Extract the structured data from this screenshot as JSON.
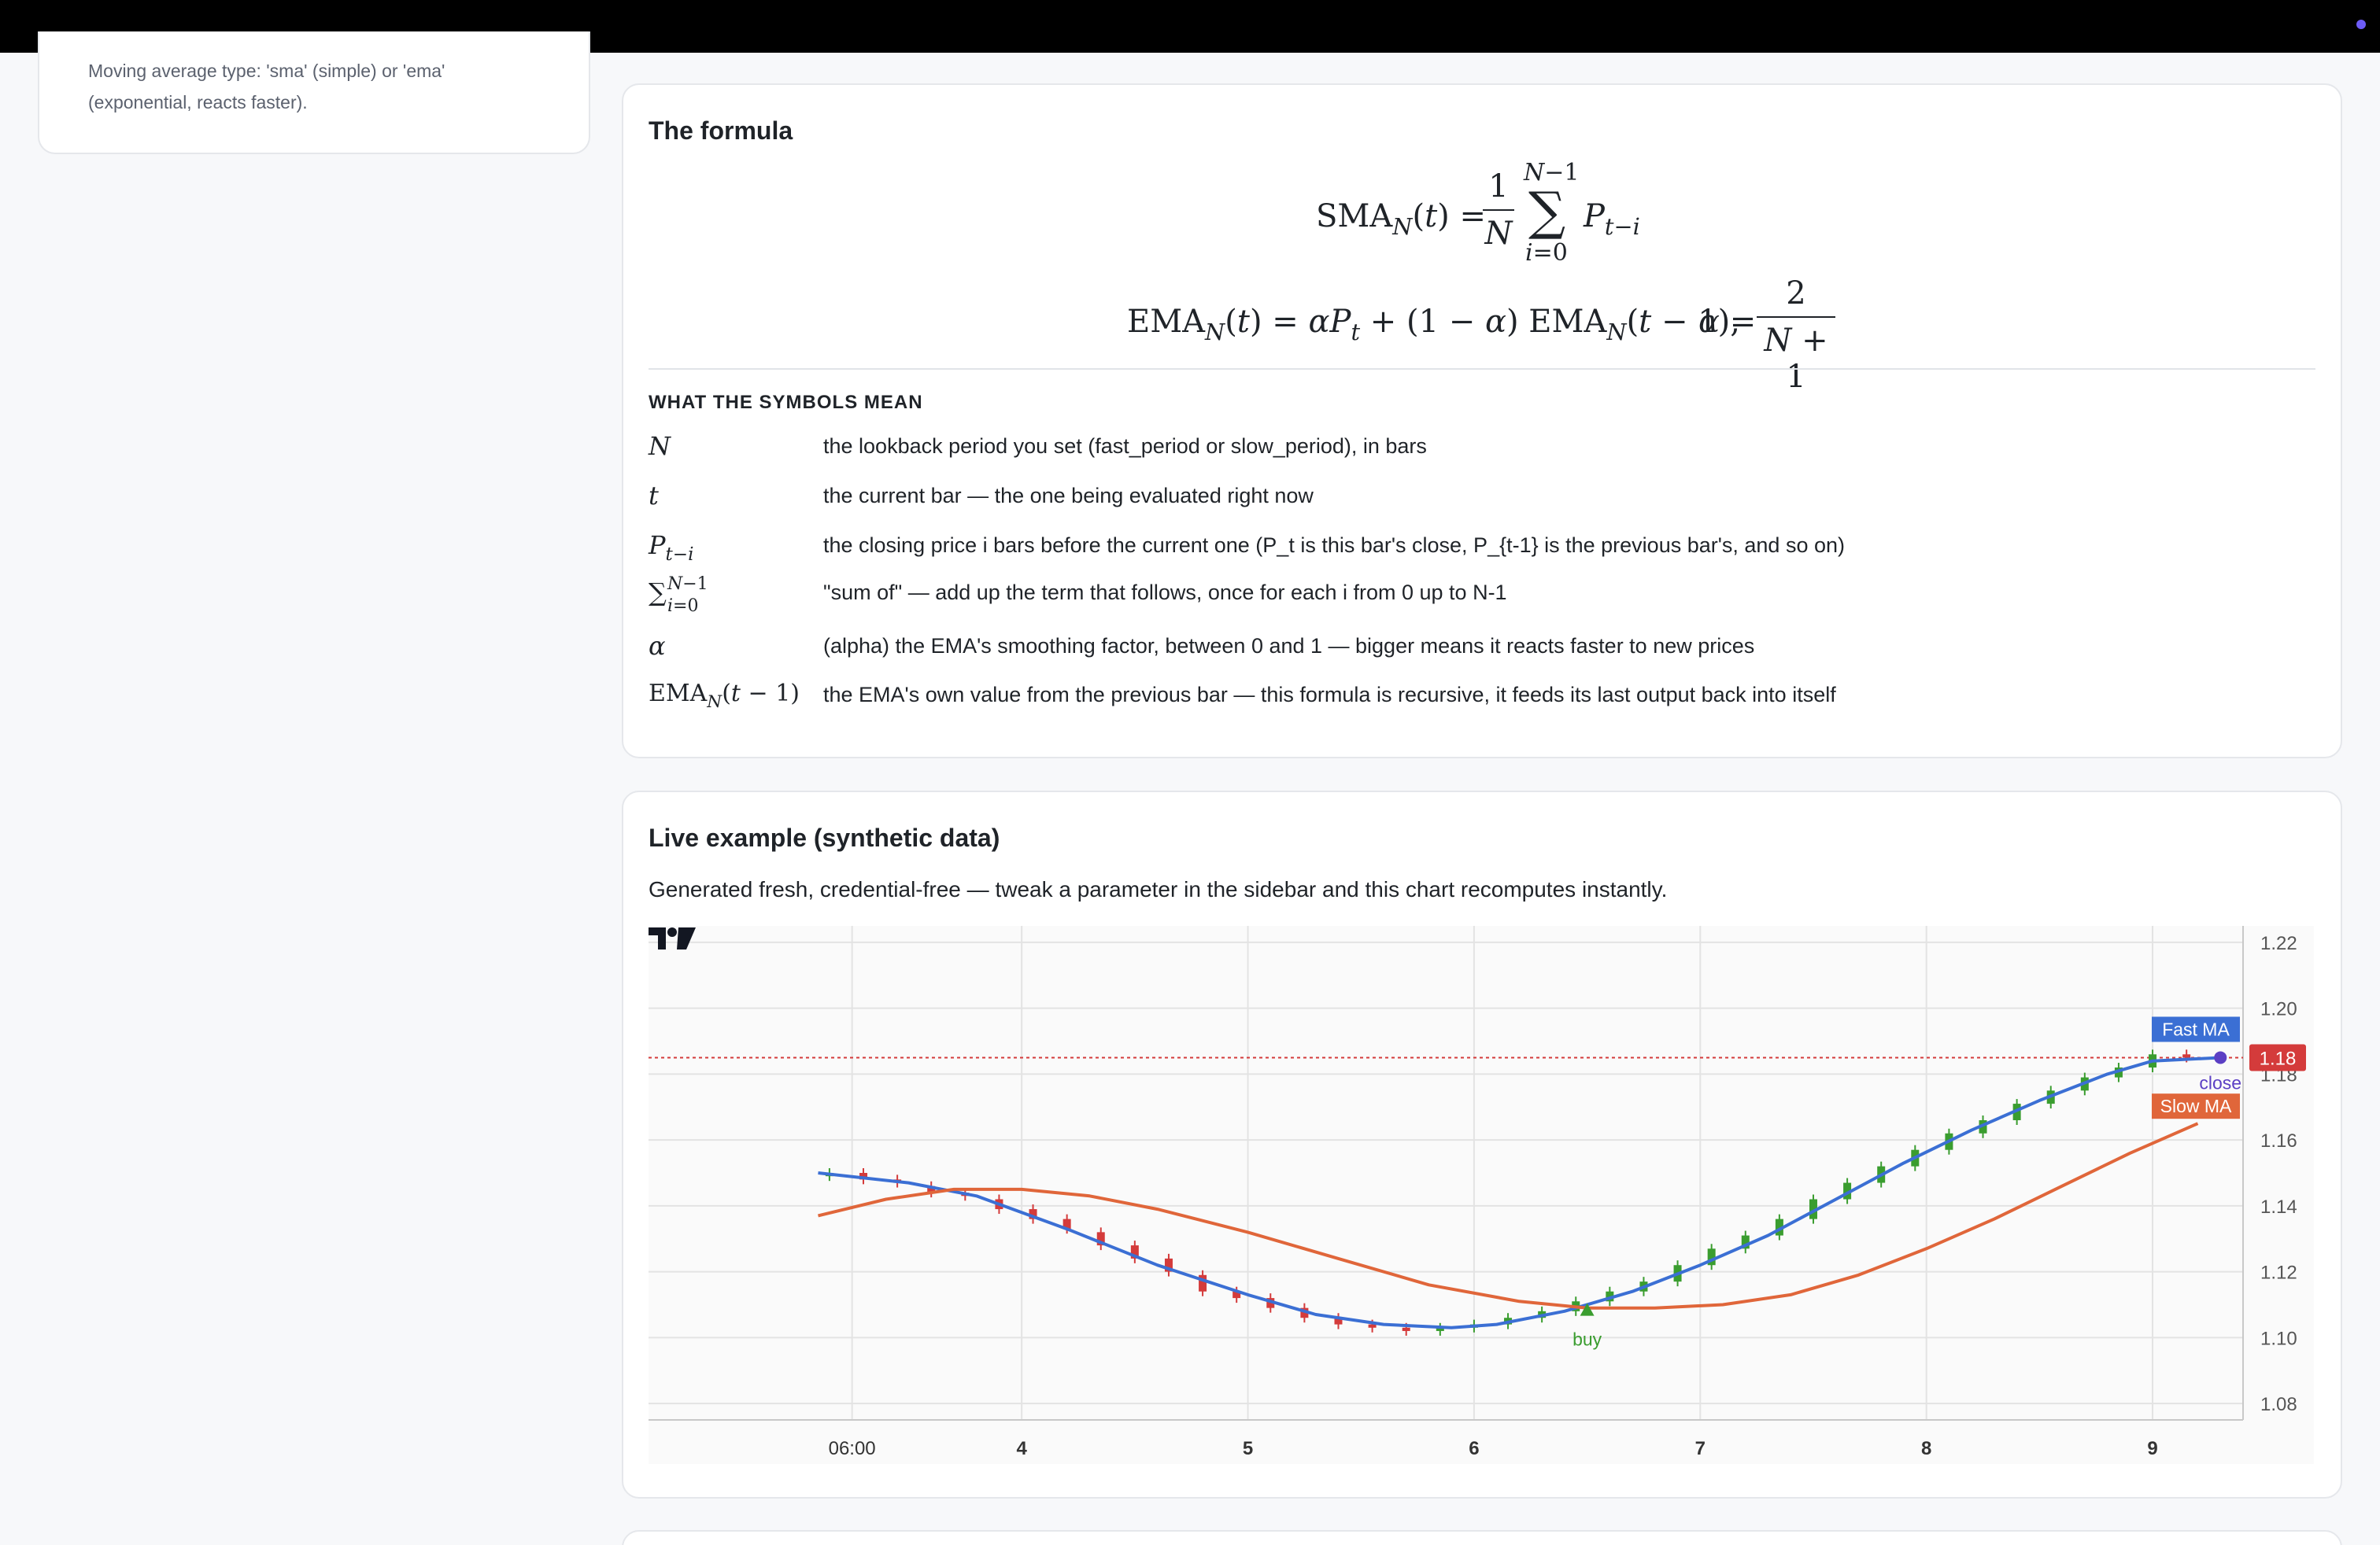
{
  "sidebar": {
    "ma_type_help": "Moving average type: 'sma' (simple) or 'ema' (exponential, reacts faster)."
  },
  "formula": {
    "title": "The formula",
    "symbols_title": "WHAT THE SYMBOLS MEAN",
    "symbols": [
      {
        "symbol": "N",
        "meaning": "the lookback period you set (fast_period or slow_period), in bars"
      },
      {
        "symbol": "t",
        "meaning": "the current bar — the one being evaluated right now"
      },
      {
        "symbol": "P_{t-i}",
        "meaning": "the closing price i bars before the current one (P_t is this bar's close, P_{t-1} is the previous bar's, and so on)"
      },
      {
        "symbol": "sum_{i=0}^{N-1}",
        "meaning": "\"sum of\" — add up the term that follows, once for each i from 0 up to N-1"
      },
      {
        "symbol": "alpha",
        "meaning": "(alpha) the EMA's smoothing factor, between 0 and 1 — bigger means it reacts faster to new prices"
      },
      {
        "symbol": "EMA_N(t-1)",
        "meaning": "the EMA's own value from the previous bar — this formula is recursive, it feeds its last output back into itself"
      }
    ]
  },
  "example": {
    "title": "Live example (synthetic data)",
    "subtitle": "Generated fresh, credential-free — tweak a parameter in the sidebar and this chart recomputes instantly."
  },
  "chart_data": {
    "type": "line",
    "y_ticks": [
      "1.22",
      "1.20",
      "1.18",
      "1.16",
      "1.14",
      "1.12",
      "1.10",
      "1.08"
    ],
    "ylim": [
      1.075,
      1.225
    ],
    "x_ticks": [
      {
        "label": "06:00",
        "x": 3.25
      },
      {
        "label": "4",
        "x": 4
      },
      {
        "label": "5",
        "x": 5
      },
      {
        "label": "6",
        "x": 6
      },
      {
        "label": "7",
        "x": 7
      },
      {
        "label": "8",
        "x": 8
      },
      {
        "label": "9",
        "x": 9
      }
    ],
    "xlim": [
      2.35,
      9.4
    ],
    "close_price": 1.185,
    "close_price_label": "1.18",
    "series": [
      {
        "name": "Fast MA",
        "color": "#3b6fd4",
        "x": [
          3.1,
          3.5,
          3.8,
          4.2,
          4.6,
          5.0,
          5.3,
          5.6,
          5.9,
          6.1,
          6.4,
          6.7,
          7.0,
          7.3,
          7.6,
          7.9,
          8.2,
          8.5,
          8.8,
          9.0,
          9.3
        ],
        "y": [
          1.15,
          1.147,
          1.143,
          1.133,
          1.122,
          1.113,
          1.107,
          1.104,
          1.103,
          1.104,
          1.108,
          1.114,
          1.122,
          1.131,
          1.142,
          1.153,
          1.163,
          1.172,
          1.18,
          1.184,
          1.185
        ]
      },
      {
        "name": "Slow MA",
        "color": "#e0663a",
        "x": [
          3.1,
          3.4,
          3.7,
          4.0,
          4.3,
          4.6,
          5.0,
          5.4,
          5.8,
          6.2,
          6.5,
          6.8,
          7.1,
          7.4,
          7.7,
          8.0,
          8.3,
          8.6,
          8.9,
          9.2
        ],
        "y": [
          1.137,
          1.142,
          1.145,
          1.145,
          1.143,
          1.139,
          1.132,
          1.124,
          1.116,
          1.111,
          1.109,
          1.109,
          1.11,
          1.113,
          1.119,
          1.127,
          1.136,
          1.146,
          1.156,
          1.165
        ]
      }
    ],
    "candles": [
      {
        "x": 3.15,
        "o": 1.149,
        "c": 1.15
      },
      {
        "x": 3.3,
        "o": 1.15,
        "c": 1.148
      },
      {
        "x": 3.45,
        "o": 1.148,
        "c": 1.147
      },
      {
        "x": 3.6,
        "o": 1.146,
        "c": 1.144
      },
      {
        "x": 3.75,
        "o": 1.144,
        "c": 1.143
      },
      {
        "x": 3.9,
        "o": 1.142,
        "c": 1.139
      },
      {
        "x": 4.05,
        "o": 1.139,
        "c": 1.136
      },
      {
        "x": 4.2,
        "o": 1.136,
        "c": 1.133
      },
      {
        "x": 4.35,
        "o": 1.132,
        "c": 1.128
      },
      {
        "x": 4.5,
        "o": 1.128,
        "c": 1.124
      },
      {
        "x": 4.65,
        "o": 1.124,
        "c": 1.12
      },
      {
        "x": 4.8,
        "o": 1.119,
        "c": 1.114
      },
      {
        "x": 4.95,
        "o": 1.114,
        "c": 1.112
      },
      {
        "x": 5.1,
        "o": 1.112,
        "c": 1.109
      },
      {
        "x": 5.25,
        "o": 1.109,
        "c": 1.106
      },
      {
        "x": 5.4,
        "o": 1.106,
        "c": 1.104
      },
      {
        "x": 5.55,
        "o": 1.104,
        "c": 1.103
      },
      {
        "x": 5.7,
        "o": 1.103,
        "c": 1.102
      },
      {
        "x": 5.85,
        "o": 1.102,
        "c": 1.103
      },
      {
        "x": 6.0,
        "o": 1.103,
        "c": 1.104
      },
      {
        "x": 6.15,
        "o": 1.104,
        "c": 1.106
      },
      {
        "x": 6.3,
        "o": 1.106,
        "c": 1.108
      },
      {
        "x": 6.45,
        "o": 1.108,
        "c": 1.111
      },
      {
        "x": 6.6,
        "o": 1.111,
        "c": 1.114
      },
      {
        "x": 6.75,
        "o": 1.114,
        "c": 1.117
      },
      {
        "x": 6.9,
        "o": 1.117,
        "c": 1.122
      },
      {
        "x": 7.05,
        "o": 1.122,
        "c": 1.127
      },
      {
        "x": 7.2,
        "o": 1.127,
        "c": 1.131
      },
      {
        "x": 7.35,
        "o": 1.131,
        "c": 1.136
      },
      {
        "x": 7.5,
        "o": 1.136,
        "c": 1.142
      },
      {
        "x": 7.65,
        "o": 1.142,
        "c": 1.147
      },
      {
        "x": 7.8,
        "o": 1.147,
        "c": 1.152
      },
      {
        "x": 7.95,
        "o": 1.152,
        "c": 1.157
      },
      {
        "x": 8.1,
        "o": 1.157,
        "c": 1.162
      },
      {
        "x": 8.25,
        "o": 1.162,
        "c": 1.166
      },
      {
        "x": 8.4,
        "o": 1.166,
        "c": 1.171
      },
      {
        "x": 8.55,
        "o": 1.171,
        "c": 1.175
      },
      {
        "x": 8.7,
        "o": 1.175,
        "c": 1.179
      },
      {
        "x": 8.85,
        "o": 1.179,
        "c": 1.182
      },
      {
        "x": 9.0,
        "o": 1.182,
        "c": 1.186
      },
      {
        "x": 9.15,
        "o": 1.186,
        "c": 1.185
      },
      {
        "x": 9.3,
        "o": 1.185,
        "c": 1.185
      }
    ],
    "markers": [
      {
        "label": "buy",
        "x": 6.5,
        "y": 1.109,
        "color": "#3a9d2f"
      },
      {
        "label": "close",
        "x": 9.3,
        "y": 1.185,
        "color": "#5b3fc4"
      }
    ],
    "colors": {
      "up": "#3a9d2f",
      "down": "#d43b3b",
      "close_line": "#d43b3b"
    }
  }
}
